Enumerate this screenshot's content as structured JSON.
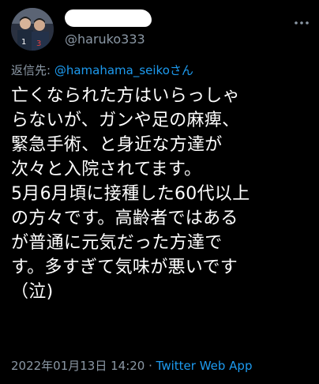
{
  "author": {
    "display_name_redacted": true,
    "handle": "@haruko333",
    "avatar": "avatar-photo-two-players"
  },
  "reply": {
    "prefix": "返信先: ",
    "to_handle": "@hamahama_seiko",
    "suffix": "さん"
  },
  "body": {
    "lines": [
      "亡くなられた方はいらっしゃ",
      "らないが、ガンや足の麻痺、",
      "緊急手術、と身近な方達が",
      "次々と入院されてます。",
      "5月6月頃に接種した60代以上",
      "の方々です。高齢者ではある",
      "が普通に元気だった方達で",
      "す。多すぎて気味が悪いです",
      "（泣)"
    ]
  },
  "meta": {
    "timestamp": "2022年01月13日 14:20",
    "separator": " · ",
    "source_app": "Twitter Web App"
  },
  "icons": {
    "more": "more-dots-icon"
  },
  "colors": {
    "background": "#000000",
    "text": "#ffffff",
    "secondary": "#8b98a5",
    "accent": "#1d9bf0"
  }
}
